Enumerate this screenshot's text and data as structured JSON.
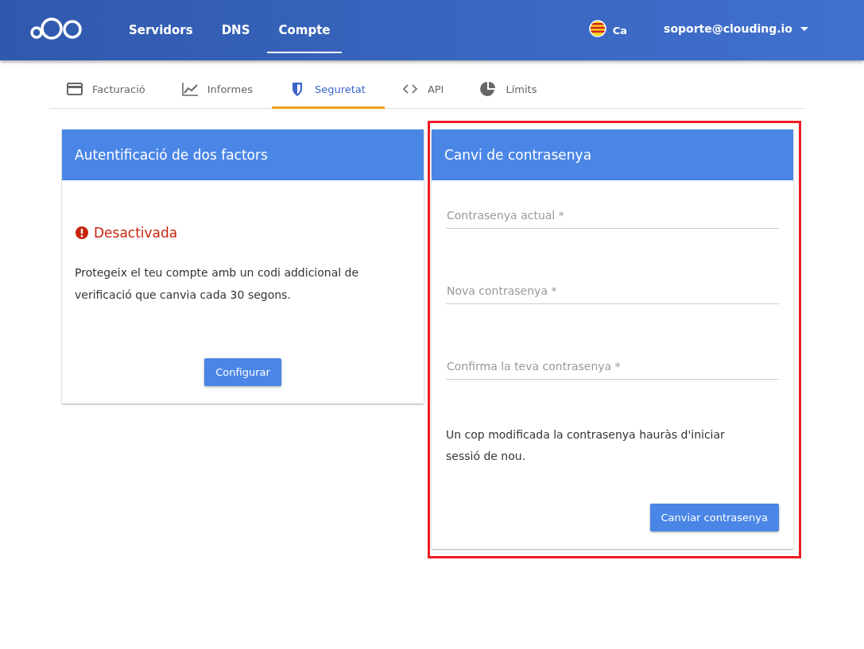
{
  "topbar": {
    "nav": [
      {
        "label": "Servidors",
        "selected": false
      },
      {
        "label": "DNS",
        "selected": false
      },
      {
        "label": "Compte",
        "selected": true
      }
    ],
    "language": "Ca",
    "account": "soporte@clouding.io"
  },
  "tabs": [
    {
      "label": "Facturació",
      "kind": "card",
      "selected": false
    },
    {
      "label": "Informes",
      "kind": "chart",
      "selected": false
    },
    {
      "label": "Seguretat",
      "kind": "shield",
      "selected": true
    },
    {
      "label": "API",
      "kind": "code",
      "selected": false
    },
    {
      "label": "Límits",
      "kind": "pie",
      "selected": false
    }
  ],
  "two_factor": {
    "title": "Autentificació de dos factors",
    "status": "Desactivada",
    "enabled": false,
    "description": "Protegeix el teu compte amb un codi addicional de verificació que canvia cada 30 segons.",
    "button": "Configurar"
  },
  "password": {
    "title": "Canvi de contrasenya",
    "highlighted": true,
    "fields": [
      {
        "placeholder": "Contrasenya actual *"
      },
      {
        "placeholder": "Nova contrasenya *"
      },
      {
        "placeholder": "Confirma la teva contrasenya *"
      }
    ],
    "note": "Un cop modificada la contrasenya hauràs d'iniciar sessió de nou.",
    "button": "Canviar contrasenya"
  }
}
